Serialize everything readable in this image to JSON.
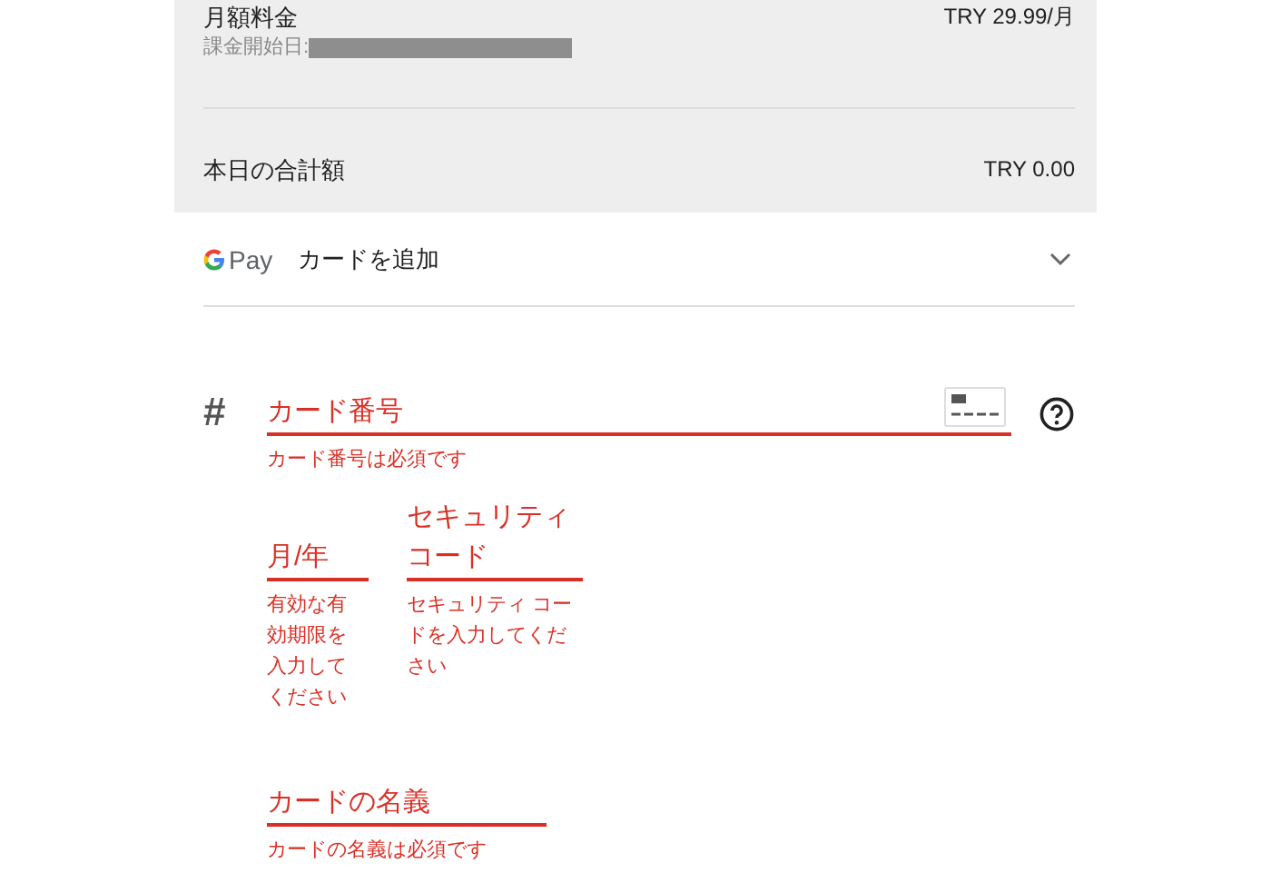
{
  "summary": {
    "rows": [
      {
        "label": "月額料金",
        "sublabel": "課金開始日:",
        "redacted": true,
        "amount": "TRY 29.99/月"
      },
      {
        "label": "本日の合計額",
        "amount": "TRY 0.00"
      }
    ]
  },
  "payment_method": {
    "brand": "Pay",
    "label": "カードを追加",
    "expanded": false
  },
  "form": {
    "fields": [
      {
        "kind": "card_number",
        "icon": "#",
        "placeholder": "カード番号",
        "invalid": true,
        "error": "カード番号は必須です"
      },
      {
        "kind": "expiry",
        "placeholder": "月/年",
        "invalid": true,
        "error": "有効な有効期限を入力してください"
      },
      {
        "kind": "cvc",
        "placeholder": "セキュリティコード",
        "invalid": true,
        "error": "セキュリティ コードを入力してください"
      },
      {
        "kind": "name",
        "placeholder": "カードの名義",
        "invalid": true,
        "error": "カードの名義は必須です"
      }
    ]
  }
}
